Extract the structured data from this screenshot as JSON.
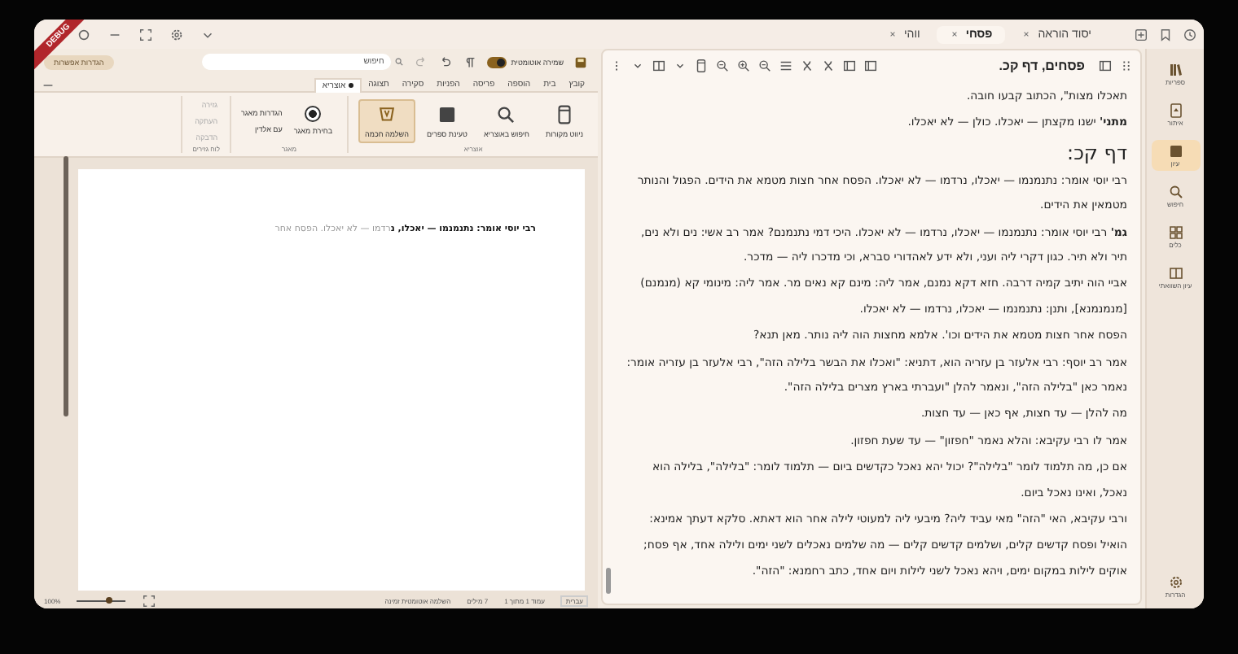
{
  "debug_banner": "DEBUG",
  "tabs": [
    {
      "label": "יסוד הוראה",
      "selected": false
    },
    {
      "label": "פסחי",
      "selected": true
    },
    {
      "label": "ווהי",
      "selected": false
    }
  ],
  "sidebar": {
    "items": [
      {
        "label": "ספריות",
        "selected": false
      },
      {
        "label": "איתור",
        "selected": false
      },
      {
        "label": "עיון",
        "selected": true
      },
      {
        "label": "חיפוש",
        "selected": false
      },
      {
        "label": "כלים",
        "selected": false
      },
      {
        "label": "עיון השוואתי",
        "selected": false
      }
    ],
    "settings_label": "הגדרות"
  },
  "reader": {
    "title": "פסחים, דף קכ.",
    "paragraphs": [
      {
        "kind": "text",
        "text": "תאכלו מצות\", הכתוב קבעו חובה."
      },
      {
        "kind": "text",
        "text": "**מתני'** ישנו מקצתן — יאכלו. כולן — לא יאכלו."
      },
      {
        "kind": "heading",
        "text": "דף קכ:"
      },
      {
        "kind": "text",
        "text": "רבי יוסי אומר: נתנמנמו — יאכלו, נרדמו — לא יאכלו. הפסח אחר חצות מטמא את הידים. הפגול והנותר מטמאין את הידים."
      },
      {
        "kind": "text",
        "text": "**גמ'** רבי יוסי אומר: נתנמנמו — יאכלו, נרדמו — לא יאכלו. היכי דמי נתנמנם? אמר רב אשי: נים ולא נים, תיר ולא תיר. כגון דקרי ליה ועני, ולא ידע לאהדורי סברא, וכי מדכרו ליה — מדכר."
      },
      {
        "kind": "text",
        "text": "אביי הוה יתיב קמיה דרבה. חזא דקא נמנם, אמר ליה: מינם קא נאים מר. אמר ליה: מינומי קא (מנמנם) [מנמנמנא], ותנן: נתנמנמו — יאכלו, נרדמו — לא יאכלו."
      },
      {
        "kind": "text",
        "text": "הפסח אחר חצות מטמא את הידים וכו'. אלמא מחצות הוה ליה נותר. מאן תנא?"
      },
      {
        "kind": "text",
        "text": "אמר רב יוסף: רבי אלעזר בן עזריה הוא, דתניא: \"ואכלו את הבשר בלילה הזה\", רבי אלעזר בן עזריה אומר: נאמר כאן \"בלילה הזה\", ונאמר להלן \"ועברתי בארץ מצרים בלילה הזה\"."
      },
      {
        "kind": "text",
        "text": "מה להלן — עד חצות, אף כאן — עד חצות."
      },
      {
        "kind": "text",
        "text": "אמר לו רבי עקיבא: והלא נאמר \"חפזון\" — עד שעת חפזון."
      },
      {
        "kind": "text",
        "text": "אם כן, מה תלמוד לומר \"בלילה\"? יכול יהא נאכל כקדשים ביום — תלמוד לומר: \"בלילה\", בלילה הוא נאכל, ואינו נאכל ביום."
      },
      {
        "kind": "text",
        "text": "ורבי עקיבא, האי \"הזה\" מאי עביד ליה? מיבעי ליה למעוטי לילה אחר הוא דאתא. סלקא דעתך אמינא: הואיל ופסח קדשים קלים, ושלמים קדשים קלים — מה שלמים נאכלים לשני ימים ולילה אחד, אף פסח;"
      },
      {
        "kind": "text",
        "text": "אוקים לילות במקום ימים, ויהא נאכל לשני לילות ויום אחד, כתב רחמנא: \"הזה\"."
      }
    ]
  },
  "editor": {
    "autosave": {
      "label": "שמירה אוטומטית",
      "on": true
    },
    "search": {
      "placeholder": "חיפוש"
    },
    "options_button": "הגדרות אפשרות",
    "ribbon_tabs": [
      {
        "label": "קובץ",
        "selected": false
      },
      {
        "label": "בית",
        "selected": false
      },
      {
        "label": "הוספה",
        "selected": false
      },
      {
        "label": "פריסה",
        "selected": false
      },
      {
        "label": "הפניות",
        "selected": false
      },
      {
        "label": "סקירה",
        "selected": false
      },
      {
        "label": "תצוגה",
        "selected": false
      },
      {
        "label": "אוצריא",
        "selected": true
      }
    ],
    "ribbon_groups": [
      {
        "label": "אוצריא",
        "items": [
          {
            "kind": "button",
            "label": "ניווט מקורות",
            "selected": false
          },
          {
            "kind": "button",
            "label": "חיפוש באוצריא",
            "selected": false
          },
          {
            "kind": "button",
            "label": "טעינת ספרים",
            "selected": false
          },
          {
            "kind": "button",
            "label": "השלמה חכמה",
            "selected": true
          }
        ]
      },
      {
        "label": "מאגר",
        "items": [
          {
            "kind": "radio",
            "label": "בחירת מאגר",
            "selected": true
          },
          {
            "kind": "link",
            "label": "הגדרות מאגר",
            "selected": false
          },
          {
            "kind": "link",
            "label": "עם אלדין",
            "selected": false
          }
        ]
      },
      {
        "label": "לוח גזירים",
        "items": [
          {
            "kind": "small",
            "label": "גזירה",
            "selected": false
          },
          {
            "kind": "small",
            "label": "העתקה",
            "selected": false
          },
          {
            "kind": "small",
            "label": "הדבקה",
            "selected": false
          }
        ]
      }
    ],
    "page": {
      "typed": "רבי יוסי אומר: נתנמנמו — יאכלו, נ",
      "suggestion": "רדמו — לא יאכלו. הפסח אחר"
    },
    "status": {
      "language": "עברית",
      "page": "עמוד 1 מתוך 1",
      "words": "7 מילים",
      "hint": "השלמה אוטומטית זמינה",
      "zoom": "100%",
      "level": 0.65
    }
  }
}
